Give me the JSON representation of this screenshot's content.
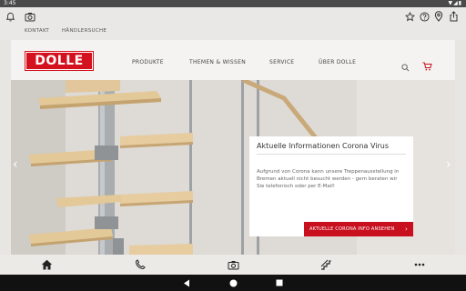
{
  "status": {
    "time": "3:45",
    "system_icons": "▼◢▮"
  },
  "toplinks": {
    "kontakt": "KONTAKT",
    "haendlersuche": "HÄNDLERSUCHE"
  },
  "header": {
    "logo": "DOLLE",
    "nav": [
      "PRODUKTE",
      "THEMEN & WISSEN",
      "SERVICE",
      "ÜBER DOLLE"
    ]
  },
  "hero": {
    "card_title": "Aktuelle Informationen Corona Virus",
    "card_body": "Aufgrund von Corona kann unsere Treppenausstellung in Bremen aktuell nicht besucht werden - gern beraten wir Sie telefonisch oder per E-Mail!",
    "card_button": "AKTUELLE CORONA INFO ANSEHEN",
    "prev": "‹",
    "next": "›"
  },
  "colors": {
    "brand_red": "#d4111e",
    "button_red": "#c8101e"
  }
}
